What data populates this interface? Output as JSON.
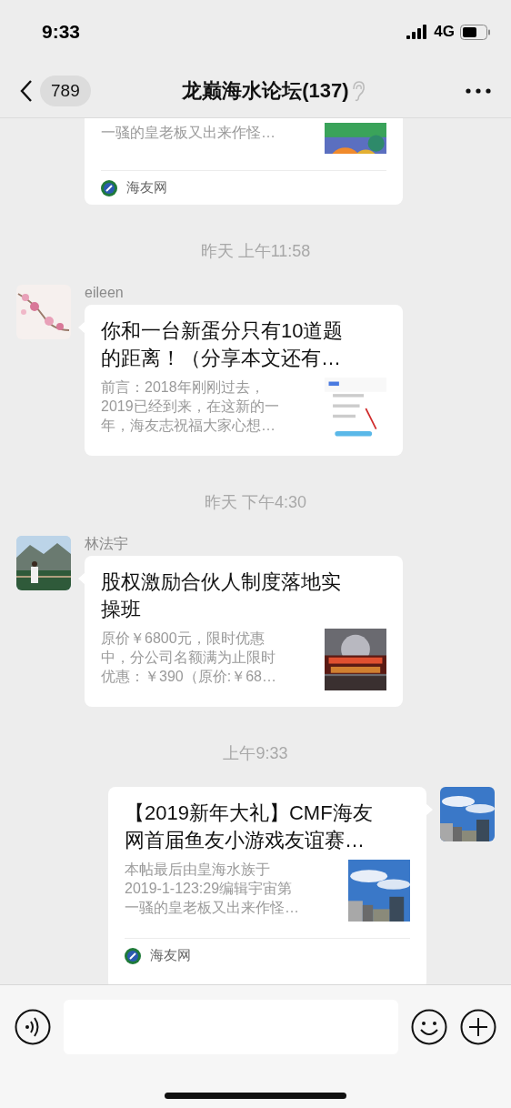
{
  "status_bar": {
    "time": "9:33",
    "network": "4G"
  },
  "header": {
    "unread_badge": "789",
    "title": "龙巅海水论坛(137)"
  },
  "messages": [
    {
      "kind": "card_fragment",
      "description_lines": [
        "一骚的皇老板又出来作怪…"
      ],
      "thumbnail": {
        "kind": "picture"
      },
      "source": "海友网"
    },
    {
      "kind": "time",
      "text": "昨天 上午11:58"
    },
    {
      "kind": "incoming_card",
      "sender": "eileen",
      "avatar": {
        "kind": "picture"
      },
      "title_lines": [
        "你和一台新蛋分只有10道题",
        "的距离！（分享本文还有…"
      ],
      "description_lines": [
        "前言：2018年刚刚过去，",
        "2019已经到来，在这新的一",
        "年，海友志祝福大家心想…"
      ],
      "thumbnail": {
        "kind": "picture"
      }
    },
    {
      "kind": "time",
      "text": "昨天 下午4:30"
    },
    {
      "kind": "incoming_card",
      "sender": "林法宇",
      "avatar": {
        "kind": "picture"
      },
      "title_lines": [
        "股权激励合伙人制度落地实",
        "操班"
      ],
      "description_lines": [
        "原价￥6800元，限时优惠",
        "中，分公司名额满为止限时",
        "优惠：￥390（原价:￥68…"
      ],
      "thumbnail": {
        "kind": "picture"
      }
    },
    {
      "kind": "time",
      "text": "上午9:33"
    },
    {
      "kind": "outgoing_card",
      "avatar": {
        "kind": "picture"
      },
      "title_lines": [
        "【2019新年大礼】CMF海友",
        "网首届鱼友小游戏友谊赛…"
      ],
      "description_lines": [
        "本帖最后由皇海水族于",
        "2019-1-123:29编辑宇宙第",
        "一骚的皇老板又出来作怪…"
      ],
      "thumbnail": {
        "kind": "picture"
      },
      "source": "海友网"
    }
  ]
}
